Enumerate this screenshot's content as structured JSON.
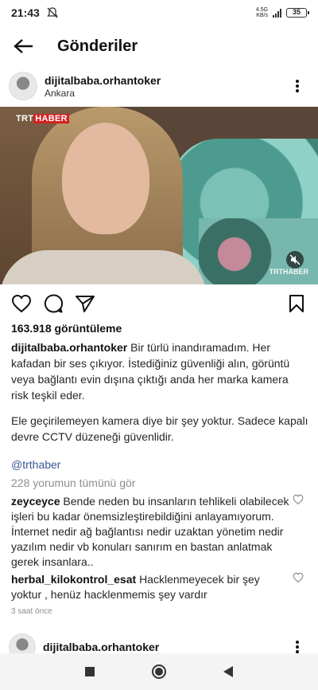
{
  "status": {
    "time": "21:43",
    "network_top": "4.5G",
    "network_bottom": "KB/s",
    "battery": "35"
  },
  "header": {
    "title": "Gönderiler"
  },
  "post": {
    "username": "dijitalbaba.orhantoker",
    "location": "Ankara",
    "video": {
      "brand_left_white": "TRT",
      "brand_left_red": "HABER",
      "brand_right": "TRTHABER"
    },
    "views": "163.918 görüntüleme",
    "caption_username": "dijitalbaba.orhantoker",
    "caption_text": "Bir türlü inandıramadım. Her kafadan bir ses çıkıyor. İstediğiniz güvenliği alın, görüntü veya bağlantı evin dışına çıktığı anda her marka kamera risk teşkil eder.",
    "caption_text2": "Ele geçirilemeyen kamera diye bir şey yoktur. Sadece kapalı devre CCTV düzeneği güvenlidir.",
    "mention": "@trthaber",
    "view_all_comments": "228 yorumun tümünü gör",
    "comments": [
      {
        "username": "zeyceyce",
        "text": "Bende neden bu insanların tehlikeli olabilecek işleri bu kadar önemsizleştirebildiğini anlayamıyorum. İnternet nedir ağ bağlantısı nedir uzaktan yönetim nedir yazılım nedir vb konuları sanırım en bastan anlatmak gerek insanlara.."
      },
      {
        "username": "herbal_kilokontrol_esat",
        "text": "Hacklenmeyecek bir şey yoktur , henüz hacklenmemis şey vardır"
      }
    ],
    "timestamp": "3 saat önce"
  },
  "next_post": {
    "username": "dijitalbaba.orhantoker"
  },
  "icons": {
    "back": "arrow-left-icon",
    "more": "more-vertical-icon",
    "like": "heart-icon",
    "comment": "comment-icon",
    "share": "send-icon",
    "save": "bookmark-icon",
    "mute": "speaker-muted-icon",
    "nav_recent": "square-icon",
    "nav_home": "circle-icon",
    "nav_back": "triangle-back-icon"
  }
}
